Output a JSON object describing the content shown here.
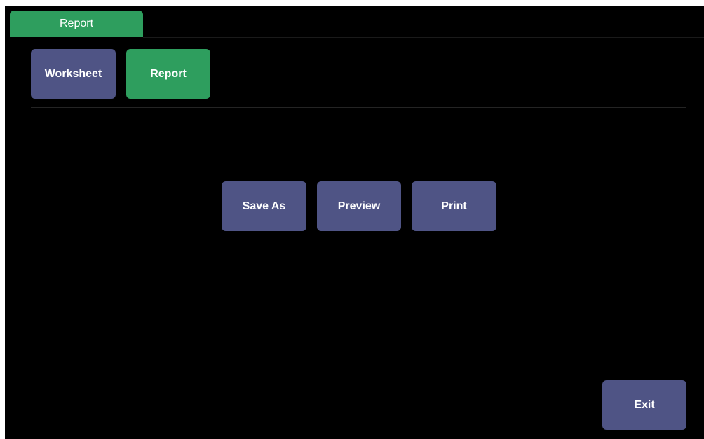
{
  "tab": {
    "label": "Report"
  },
  "nav": {
    "worksheet_label": "Worksheet",
    "report_label": "Report"
  },
  "actions": {
    "save_as_label": "Save As",
    "preview_label": "Preview",
    "print_label": "Print"
  },
  "footer": {
    "exit_label": "Exit"
  },
  "colors": {
    "background": "#000000",
    "button": "#4f5485",
    "active": "#2e9e5e",
    "text": "#ffffff"
  }
}
